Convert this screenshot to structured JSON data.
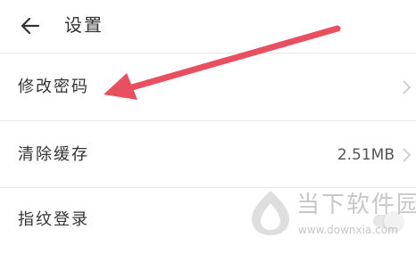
{
  "header": {
    "title": "设置",
    "back_icon": "arrow-left-icon"
  },
  "settings": {
    "change_password": {
      "label": "修改密码",
      "icon": "chevron-right-icon"
    },
    "clear_cache": {
      "label": "清除缓存",
      "value": "2.51MB",
      "icon": "chevron-right-icon"
    },
    "fingerprint_login": {
      "label": "指纹登录",
      "enabled": false
    }
  },
  "watermark": {
    "title": "当下软件园",
    "url": "www.downxia.com"
  },
  "colors": {
    "annotation_arrow": "#e8505f",
    "divider": "#e8e8e8",
    "text": "#333333"
  }
}
